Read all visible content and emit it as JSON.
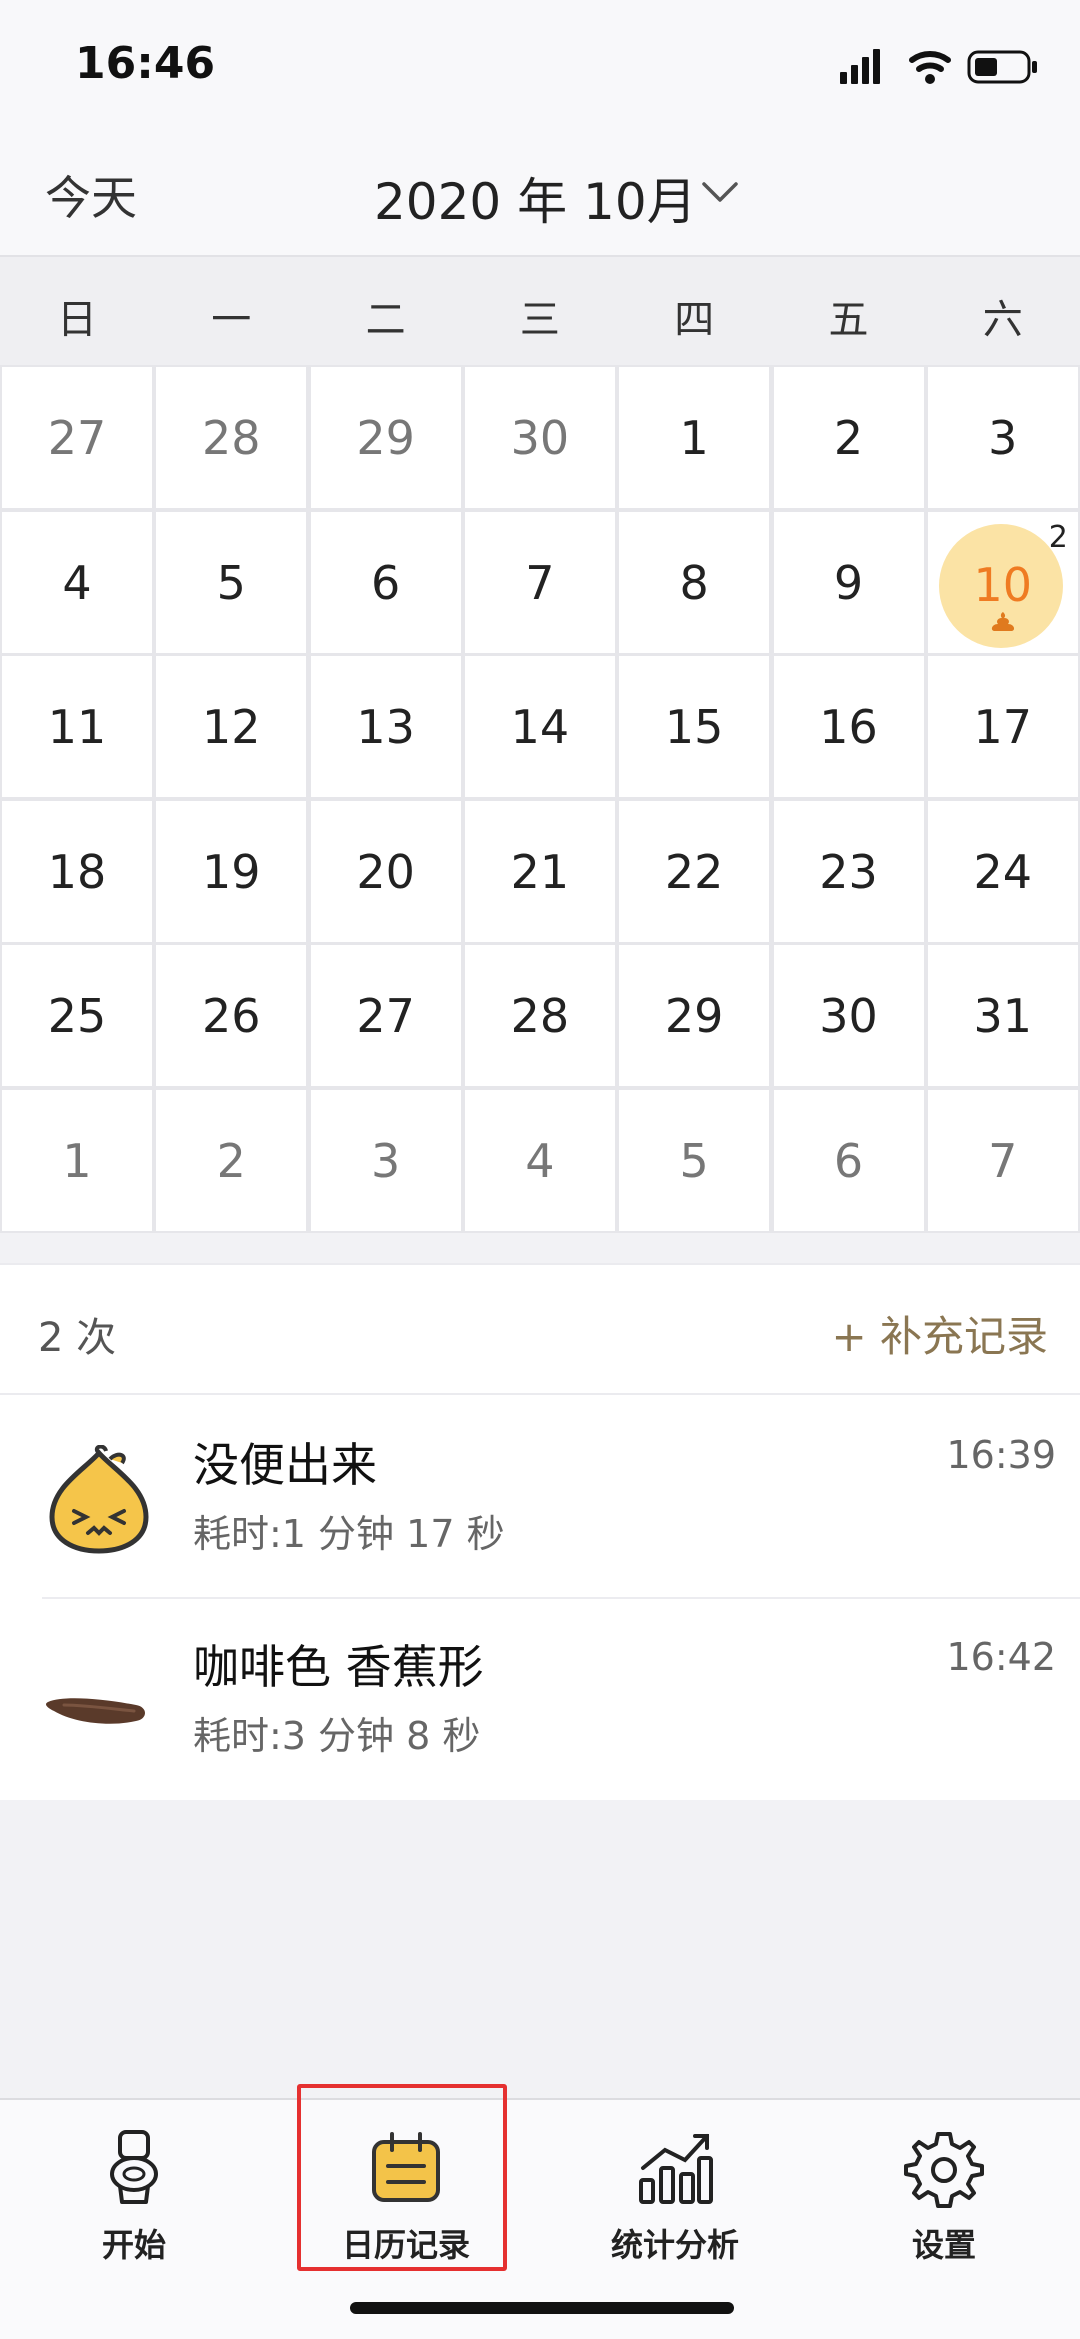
{
  "status": {
    "time": "16:46"
  },
  "header": {
    "today": "今天",
    "month": "2020 年 10月"
  },
  "weekdays": [
    "日",
    "一",
    "二",
    "三",
    "四",
    "五",
    "六"
  ],
  "calendar": {
    "days": [
      {
        "n": "27",
        "muted": true
      },
      {
        "n": "28",
        "muted": true
      },
      {
        "n": "29",
        "muted": true
      },
      {
        "n": "30",
        "muted": true
      },
      {
        "n": "1"
      },
      {
        "n": "2"
      },
      {
        "n": "3"
      },
      {
        "n": "4"
      },
      {
        "n": "5"
      },
      {
        "n": "6"
      },
      {
        "n": "7"
      },
      {
        "n": "8"
      },
      {
        "n": "9"
      },
      {
        "n": "10",
        "today": true,
        "badge": "2"
      },
      {
        "n": "11"
      },
      {
        "n": "12"
      },
      {
        "n": "13"
      },
      {
        "n": "14"
      },
      {
        "n": "15"
      },
      {
        "n": "16"
      },
      {
        "n": "17"
      },
      {
        "n": "18"
      },
      {
        "n": "19"
      },
      {
        "n": "20"
      },
      {
        "n": "21"
      },
      {
        "n": "22"
      },
      {
        "n": "23"
      },
      {
        "n": "24"
      },
      {
        "n": "25"
      },
      {
        "n": "26"
      },
      {
        "n": "27"
      },
      {
        "n": "28"
      },
      {
        "n": "29"
      },
      {
        "n": "30"
      },
      {
        "n": "31"
      },
      {
        "n": "1",
        "muted": true
      },
      {
        "n": "2",
        "muted": true
      },
      {
        "n": "3",
        "muted": true
      },
      {
        "n": "4",
        "muted": true
      },
      {
        "n": "5",
        "muted": true
      },
      {
        "n": "6",
        "muted": true
      },
      {
        "n": "7",
        "muted": true
      }
    ]
  },
  "summary": {
    "count": "2 次",
    "add": "+ 补充记录"
  },
  "records": [
    {
      "title": "没便出来",
      "duration": "耗时:1 分钟 17 秒",
      "time": "16:39",
      "icon": "onion-face-icon"
    },
    {
      "title": "咖啡色 香蕉形",
      "duration": "耗时:3 分钟 8 秒",
      "time": "16:42",
      "icon": "banana-stool-icon"
    }
  ],
  "tabs": [
    {
      "label": "开始",
      "icon": "toilet-icon"
    },
    {
      "label": "日历记录",
      "icon": "calendar-icon",
      "active": true
    },
    {
      "label": "统计分析",
      "icon": "chart-icon"
    },
    {
      "label": "设置",
      "icon": "gear-icon"
    }
  ],
  "colors": {
    "accent": "#ef7b22",
    "todayBg": "#fbe3a5",
    "addLink": "#8a7652",
    "highlight": "#e53030"
  }
}
